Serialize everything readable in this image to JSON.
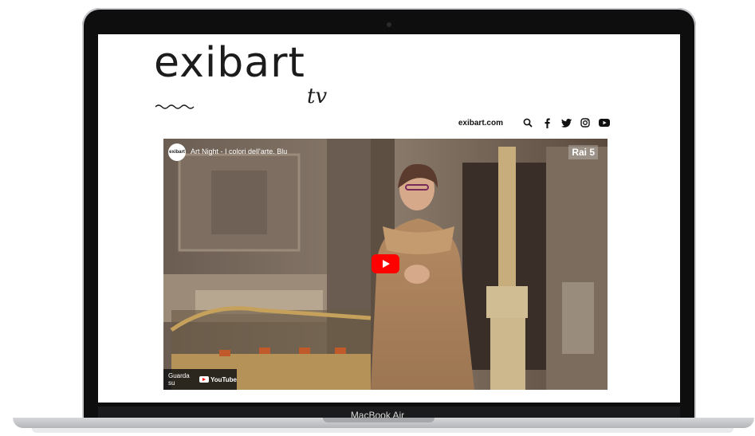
{
  "site": {
    "logo_text": "exibart",
    "logo_suffix": "tv"
  },
  "nav": {
    "link": "exibart.com",
    "icons": [
      "search-icon",
      "facebook-icon",
      "twitter-icon",
      "instagram-icon",
      "youtube-icon"
    ]
  },
  "video": {
    "channel_avatar_text": "exibart",
    "title": "Art Night - I colori dell'arte. Blu",
    "channel_badge": "Rai 5",
    "watch_on_label": "Guarda su",
    "platform_label": "YouTube"
  },
  "device": {
    "model": "MacBook Air"
  },
  "colors": {
    "youtube_red": "#ff0000",
    "bezel": "#0e0e0f"
  }
}
